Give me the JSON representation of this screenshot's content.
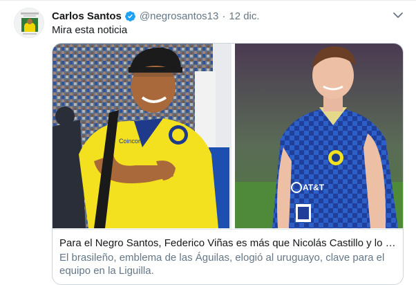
{
  "tweet": {
    "author_name": "Carlos Santos",
    "handle": "@negrosantos13",
    "separator": "·",
    "date": "12 dic.",
    "text": "Mira esta noticia",
    "verified": true,
    "icons": {
      "verified": "verified-badge-icon",
      "more": "chevron-down-icon"
    },
    "colors": {
      "verified": "#1da1f2",
      "secondary_text": "#657786",
      "border": "#ccd6dd"
    }
  },
  "card": {
    "title": "Para el Negro Santos, Federico Viñas es más que Nicolás Castillo y lo pr...",
    "description": "El brasileño, emblema de las Águilas, elogió al uruguayo, clave para el equipo en la Liguilla.",
    "left_photo": {
      "shirt_text": "Coincord"
    },
    "right_photo": {
      "shirt_sponsor": "AT&T"
    }
  }
}
